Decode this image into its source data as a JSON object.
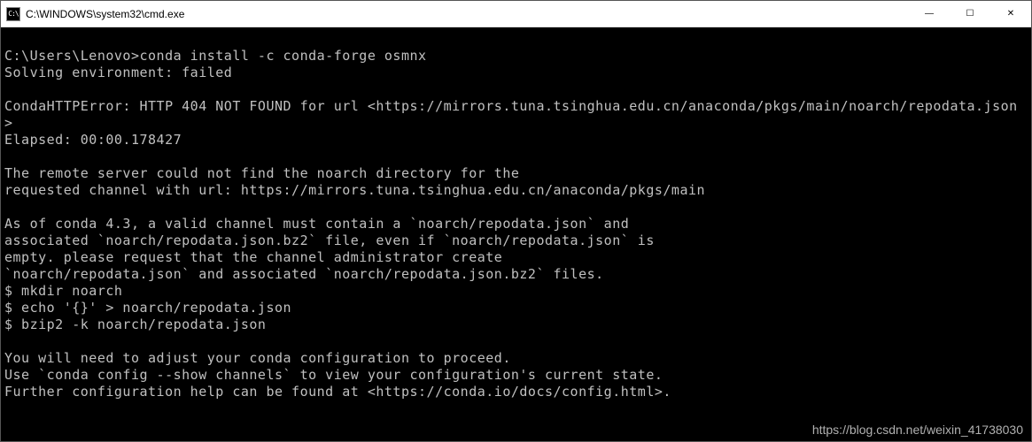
{
  "titlebar": {
    "icon_text": "C:\\",
    "title": "C:\\WINDOWS\\system32\\cmd.exe",
    "minimize_glyph": "—",
    "maximize_glyph": "☐",
    "close_glyph": "✕"
  },
  "terminal": {
    "lines": [
      "",
      "C:\\Users\\Lenovo>conda install -c conda-forge osmnx",
      "Solving environment: failed",
      "",
      "CondaHTTPError: HTTP 404 NOT FOUND for url <https://mirrors.tuna.tsinghua.edu.cn/anaconda/pkgs/main/noarch/repodata.json",
      ">",
      "Elapsed: 00:00.178427",
      "",
      "The remote server could not find the noarch directory for the",
      "requested channel with url: https://mirrors.tuna.tsinghua.edu.cn/anaconda/pkgs/main",
      "",
      "As of conda 4.3, a valid channel must contain a `noarch/repodata.json` and",
      "associated `noarch/repodata.json.bz2` file, even if `noarch/repodata.json` is",
      "empty. please request that the channel administrator create",
      "`noarch/repodata.json` and associated `noarch/repodata.json.bz2` files.",
      "$ mkdir noarch",
      "$ echo '{}' > noarch/repodata.json",
      "$ bzip2 -k noarch/repodata.json",
      "",
      "You will need to adjust your conda configuration to proceed.",
      "Use `conda config --show channels` to view your configuration's current state.",
      "Further configuration help can be found at <https://conda.io/docs/config.html>."
    ]
  },
  "watermark": "https://blog.csdn.net/weixin_41738030"
}
